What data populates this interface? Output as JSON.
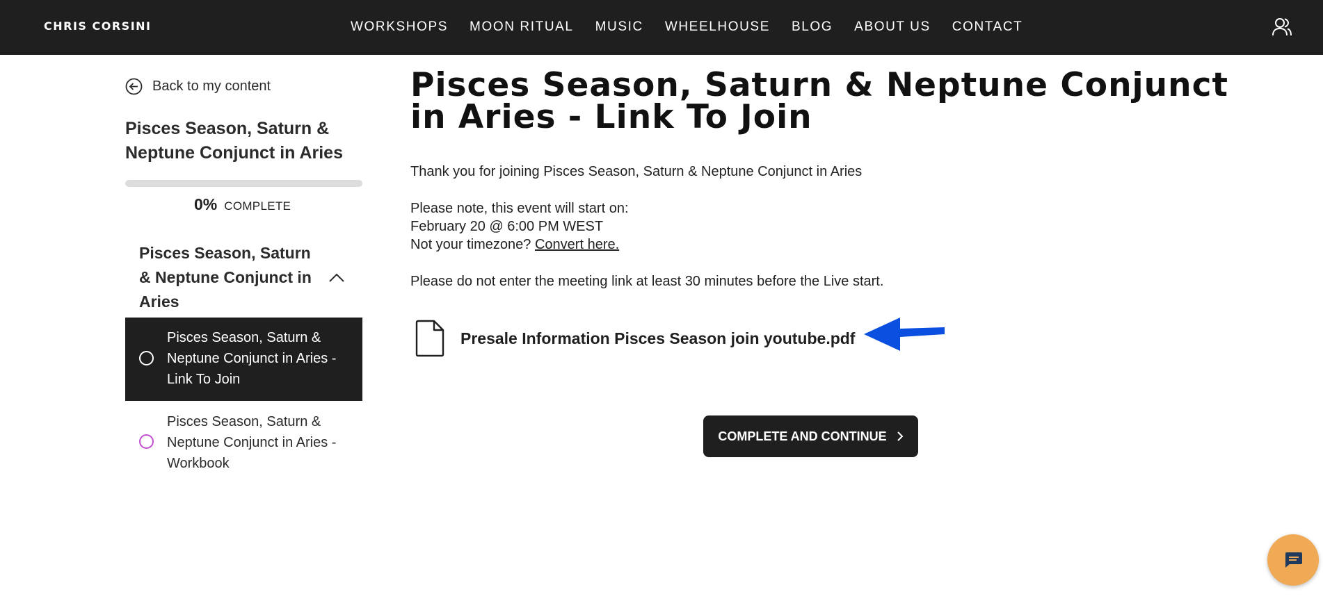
{
  "header": {
    "brand": "CHRIS CORSINI",
    "nav": [
      "WORKSHOPS",
      "MOON RITUAL",
      "MUSIC",
      "WHEELHOUSE",
      "BLOG",
      "ABOUT US",
      "CONTACT"
    ],
    "user_icon": "user-group-icon"
  },
  "sidebar": {
    "back_label": "Back to my content",
    "course_title": "Pisces Season, Saturn & Neptune Conjunct in Aries",
    "progress": {
      "percent": "0%",
      "label": "COMPLETE",
      "value": 0
    },
    "section_title": "Pisces Season, Saturn & Neptune Conjunct in Aries",
    "lessons": [
      {
        "label": "Pisces Season, Saturn & Neptune Conjunct in Aries - Link To Join",
        "active": true
      },
      {
        "label": "Pisces Season, Saturn & Neptune Conjunct in Aries - Workbook",
        "active": false
      }
    ]
  },
  "main": {
    "title": "Pisces Season, Saturn & Neptune Conjunct in Aries - Link To Join",
    "thanks": "Thank you for joining Pisces Season, Saturn & Neptune Conjunct in Aries",
    "note": "Please note, this event will start on:",
    "date": "February 20 @ 6:00 PM WEST",
    "tz_prefix": "Not your timezone?",
    "tz_link": "Convert here.",
    "warning": "Please do not enter the meeting link at least 30 minutes before the Live start.",
    "attachment": "Presale Information Pisces Season join youtube.pdf",
    "cta": "COMPLETE AND CONTINUE"
  },
  "colors": {
    "header_bg": "#1f1f1f",
    "accent_purple": "#c24fd0",
    "arrow_blue": "#0b4fe0",
    "chat_orange": "#f0a955"
  }
}
